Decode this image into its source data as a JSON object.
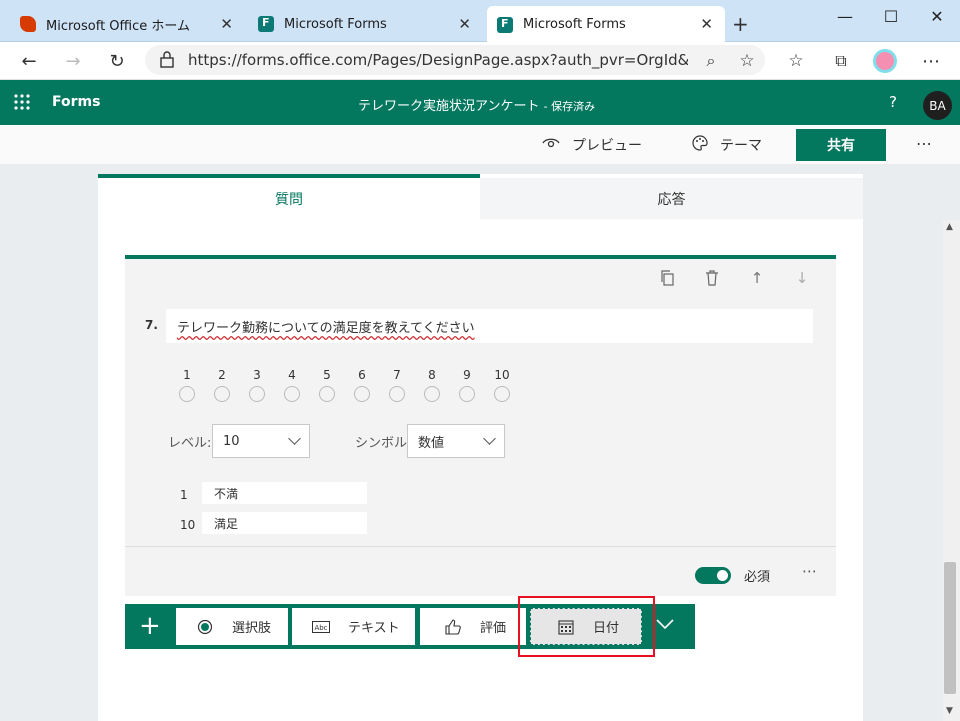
{
  "browser": {
    "tabs": [
      {
        "title": "Microsoft Office ホーム",
        "icon": "office-icon"
      },
      {
        "title": "Microsoft Forms",
        "icon": "forms-icon"
      },
      {
        "title": "Microsoft Forms",
        "icon": "forms-icon",
        "active": true
      }
    ],
    "url": "https://forms.office.com/Pages/DesignPage.aspx?auth_pvr=OrgId&a..."
  },
  "app": {
    "name": "Forms",
    "doc_title": "テレワーク実施状況アンケート",
    "saved_status": "- 保存済み",
    "help": "?",
    "avatar": "BA"
  },
  "commands": {
    "preview": "プレビュー",
    "theme": "テーマ",
    "share": "共有",
    "more": "⋯"
  },
  "tabs": {
    "questions": "質問",
    "responses": "応答"
  },
  "question": {
    "number": "7.",
    "title": "テレワーク勤務についての満足度を教えてください",
    "scale": [
      "1",
      "2",
      "3",
      "4",
      "5",
      "6",
      "7",
      "8",
      "9",
      "10"
    ],
    "level_label": "レベル:",
    "level_value": "10",
    "symbol_label": "シンボル:",
    "symbol_value": "数値",
    "low_num": "1",
    "low_label": "不満",
    "high_num": "10",
    "high_label": "満足",
    "required_label": "必須",
    "more": "⋯"
  },
  "add_bar": {
    "plus": "+",
    "choice": "選択肢",
    "text": "テキスト",
    "rating": "評価",
    "date": "日付"
  },
  "colors": {
    "accent": "#04775f",
    "highlight": "#e81123"
  }
}
